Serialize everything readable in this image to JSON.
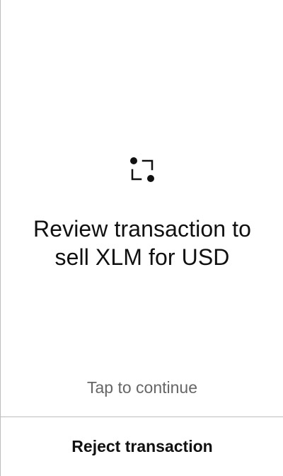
{
  "screen": {
    "icon": "scan-frame-icon",
    "headline": "Review transaction to sell XLM for USD",
    "tap_prompt": "Tap to continue",
    "reject_label": "Reject transaction"
  },
  "colors": {
    "background": "#ffffff",
    "text_primary": "#111111",
    "text_secondary": "#666666",
    "divider": "#bdbdbd"
  }
}
